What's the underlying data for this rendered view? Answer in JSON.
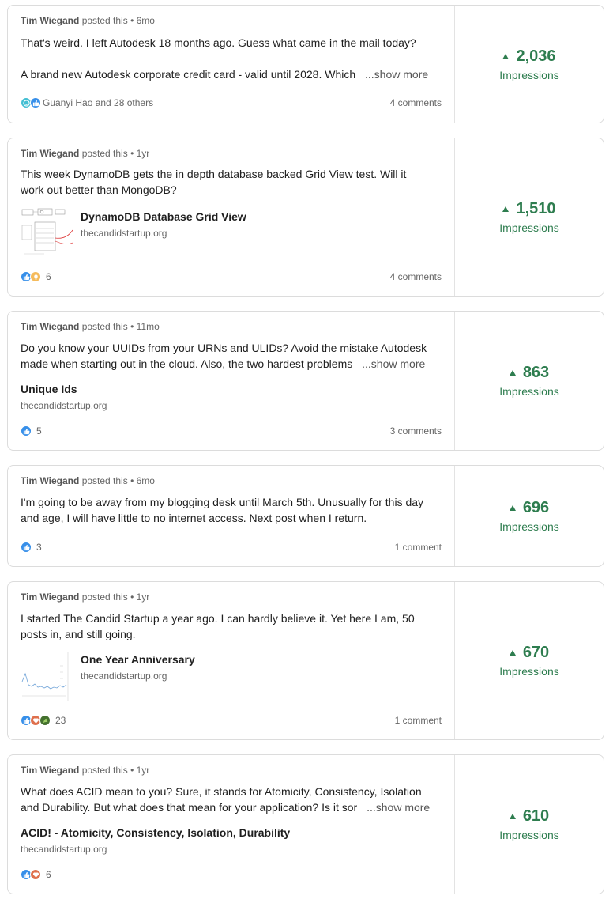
{
  "posts": [
    {
      "author": "Tim Wiegand",
      "action": "posted this",
      "age": "6mo",
      "lines": [
        "That's weird. I left Autodesk 18 months ago. Guess what came in the mail today?",
        "",
        "A brand new Autodesk corporate credit card - valid until 2028. Which"
      ],
      "show_more": "...show more",
      "reactions": "Guanyi Hao and 28 others",
      "comments": "4 comments",
      "impressions": "2,036",
      "impressions_label": "Impressions"
    },
    {
      "author": "Tim Wiegand",
      "action": "posted this",
      "age": "1yr",
      "lines": [
        "This week DynamoDB gets the in depth database backed Grid View test. Will it",
        "work out better than MongoDB?"
      ],
      "link_title": "DynamoDB Database Grid View",
      "link_domain": "thecandidstartup.org",
      "reactions": "6",
      "comments": "4 comments",
      "impressions": "1,510",
      "impressions_label": "Impressions"
    },
    {
      "author": "Tim Wiegand",
      "action": "posted this",
      "age": "11mo",
      "lines": [
        "Do you know your UUIDs from your URNs and ULIDs? Avoid the mistake Autodesk",
        "made when starting out in the cloud. Also, the two hardest problems"
      ],
      "show_more": "...show more",
      "link_title": "Unique Ids",
      "link_domain": "thecandidstartup.org",
      "reactions": "5",
      "comments": "3 comments",
      "impressions": "863",
      "impressions_label": "Impressions"
    },
    {
      "author": "Tim Wiegand",
      "action": "posted this",
      "age": "6mo",
      "lines": [
        "I'm going to be away from my blogging desk until March 5th. Unusually for this day",
        "and age, I will have little to no internet access. Next post when I return."
      ],
      "reactions": "3",
      "comments": "1 comment",
      "impressions": "696",
      "impressions_label": "Impressions"
    },
    {
      "author": "Tim Wiegand",
      "action": "posted this",
      "age": "1yr",
      "lines": [
        "I started The Candid Startup a year ago. I can hardly believe it. Yet here I am, 50",
        "posts in, and still going."
      ],
      "link_title": "One Year Anniversary",
      "link_domain": "thecandidstartup.org",
      "reactions": "23",
      "comments": "1 comment",
      "impressions": "670",
      "impressions_label": "Impressions"
    },
    {
      "author": "Tim Wiegand",
      "action": "posted this",
      "age": "1yr",
      "lines": [
        "What does ACID mean to you? Sure, it stands for Atomicity, Consistency, Isolation",
        "and Durability. But what does that mean for your application? Is it sor"
      ],
      "show_more": "...show more",
      "link_title": "ACID! - Atomicity, Consistency, Isolation, Durability",
      "link_domain": "thecandidstartup.org",
      "reactions": "6",
      "comments": "",
      "impressions": "610",
      "impressions_label": "Impressions"
    }
  ],
  "colors": {
    "impressions": "#2e7d4f",
    "like": "#378fe9",
    "love": "#df704d",
    "insightful": "#f5bb5c",
    "celebrate": "#44712e",
    "funny": "#44bfd3"
  },
  "icons": {
    "impressions_trend": "triangle-up-icon"
  }
}
